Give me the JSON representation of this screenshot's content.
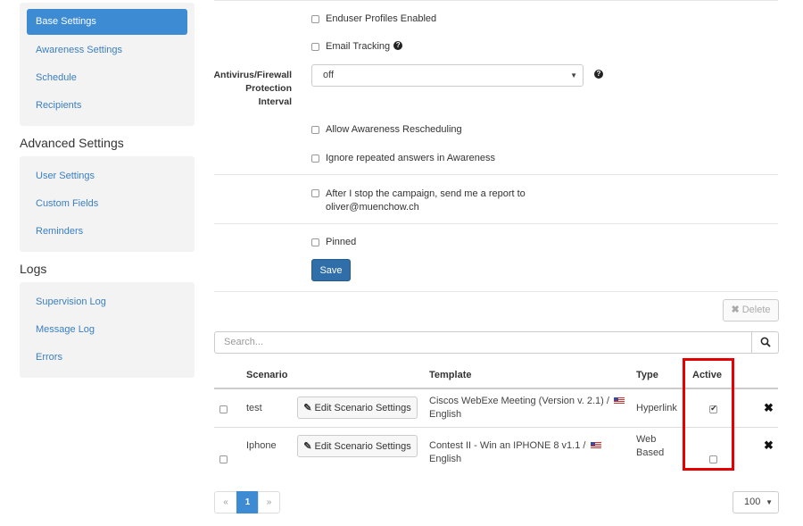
{
  "sidebar": {
    "settings_items": [
      "Base Settings",
      "Awareness Settings",
      "Schedule",
      "Recipients"
    ],
    "advanced_heading": "Advanced Settings",
    "advanced_items": [
      "User Settings",
      "Custom Fields",
      "Reminders"
    ],
    "logs_heading": "Logs",
    "logs_items": [
      "Supervision Log",
      "Message Log",
      "Errors"
    ]
  },
  "form": {
    "enduser_profiles": "Enduser Profiles Enabled",
    "email_tracking": "Email Tracking",
    "antivirus_label_1": "Antivirus/Firewall",
    "antivirus_label_2": "Protection",
    "antivirus_label_3": "Interval",
    "antivirus_value": "off",
    "allow_rescheduling": "Allow Awareness Rescheduling",
    "ignore_repeated": "Ignore repeated answers in Awareness",
    "report_line_1": "After I stop the campaign, send me a report to",
    "report_line_2": "oliver@muenchow.ch",
    "pinned": "Pinned",
    "save": "Save"
  },
  "toolbar": {
    "delete": "Delete",
    "search_placeholder": "Search..."
  },
  "table": {
    "headers": {
      "scenario": "Scenario",
      "template": "Template",
      "type": "Type",
      "active": "Active"
    },
    "rows": [
      {
        "scenario": "test",
        "edit_label": "Edit Scenario Settings",
        "template_1": "Ciscos WebExe Meeting (Version v. 2.1) /",
        "template_2": "English",
        "type_1": "Hyperlink",
        "type_2": "",
        "active": true
      },
      {
        "scenario": "Iphone",
        "edit_label": "Edit Scenario Settings",
        "template_1": "Contest II - Win an IPHONE 8 v1.1 /",
        "template_2": "English",
        "type_1": "Web",
        "type_2": "Based",
        "active": false
      }
    ]
  },
  "pagination": {
    "prev": "«",
    "current": "1",
    "next": "»",
    "page_size": "100"
  },
  "colors": {
    "accent": "#3d8bd3",
    "primary_button": "#2f6ea8",
    "highlight": "#e60000"
  }
}
